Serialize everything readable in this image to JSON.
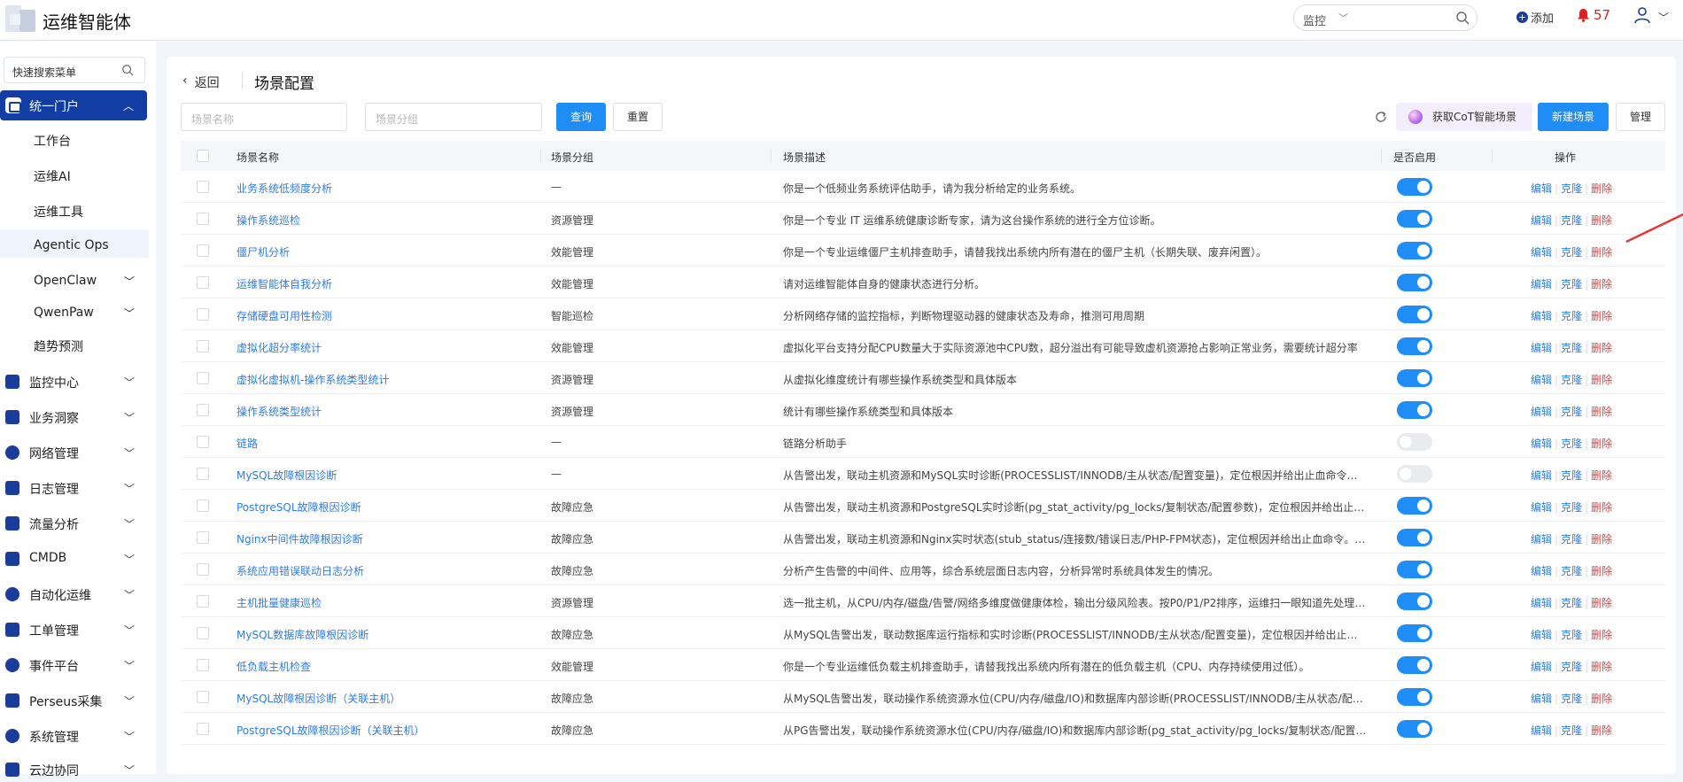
{
  "header": {
    "app_title": "运维智能体",
    "search_scope": "监控",
    "add_label": "添加",
    "alert_count": "57"
  },
  "sidebar": {
    "search_placeholder": "快速搜索菜单",
    "active": "统一门户",
    "sub_items": [
      "工作台",
      "运维AI",
      "运维工具",
      "Agentic Ops",
      "OpenClaw",
      "QwenPaw",
      "趋势预测"
    ],
    "main_items": [
      "监控中心",
      "业务洞察",
      "网络管理",
      "日志管理",
      "流量分析",
      "CMDB",
      "自动化运维",
      "工单管理",
      "事件平台",
      "Perseus采集",
      "系统管理",
      "云边协同"
    ]
  },
  "page": {
    "back_label": "返回",
    "title": "场景配置",
    "name_placeholder": "场景名称",
    "group_placeholder": "场景分组",
    "query_label": "查询",
    "reset_label": "重置",
    "cot_label": "获取CoT智能场景",
    "new_label": "新建场景",
    "manage_label": "管理"
  },
  "table": {
    "columns": [
      "场景名称",
      "场景分组",
      "场景描述",
      "是否启用",
      "操作"
    ],
    "op_labels": {
      "edit": "编辑",
      "clone": "克隆",
      "delete": "删除"
    },
    "rows": [
      {
        "name": "业务系统低频度分析",
        "group": "—",
        "desc": "你是一个低频业务系统评估助手，请为我分析给定的业务系统。",
        "enabled": true
      },
      {
        "name": "操作系统巡检",
        "group": "资源管理",
        "desc": "你是一个专业 IT 运维系统健康诊断专家，请为这台操作系统的进行全方位诊断。",
        "enabled": true
      },
      {
        "name": "僵尸机分析",
        "group": "效能管理",
        "desc": "你是一个专业运维僵尸主机排查助手，请替我找出系统内所有潜在的僵尸主机（长期失联、废弃闲置）。",
        "enabled": true
      },
      {
        "name": "运维智能体自我分析",
        "group": "效能管理",
        "desc": "请对运维智能体自身的健康状态进行分析。",
        "enabled": true
      },
      {
        "name": "存储硬盘可用性检测",
        "group": "智能巡检",
        "desc": "分析网络存储的监控指标，判断物理驱动器的健康状态及寿命，推测可用周期",
        "enabled": true
      },
      {
        "name": "虚拟化超分率统计",
        "group": "效能管理",
        "desc": "虚拟化平台支持分配CPU数量大于实际资源池中CPU数，超分溢出有可能导致虚机资源抢占影响正常业务，需要统计超分率",
        "enabled": true
      },
      {
        "name": "虚拟化虚拟机-操作系统类型统计",
        "group": "资源管理",
        "desc": "从虚拟化维度统计有哪些操作系统类型和具体版本",
        "enabled": true
      },
      {
        "name": "操作系统类型统计",
        "group": "资源管理",
        "desc": "统计有哪些操作系统类型和具体版本",
        "enabled": true
      },
      {
        "name": "链路",
        "group": "—",
        "desc": "链路分析助手",
        "enabled": false
      },
      {
        "name": "MySQL故障根因诊断",
        "group": "—",
        "desc": "从告警出发，联动主机资源和MySQL实时诊断(PROCESSLIST/INNODB/主从状态/配置变量)，定位根因并给出止血命令。…",
        "enabled": false
      },
      {
        "name": "PostgreSQL故障根因诊断",
        "group": "故障应急",
        "desc": "从告警出发，联动主机资源和PostgreSQL实时诊断(pg_stat_activity/pg_locks/复制状态/配置参数)，定位根因并给出止血…",
        "enabled": true
      },
      {
        "name": "Nginx中间件故障根因诊断",
        "group": "故障应急",
        "desc": "从告警出发，联动主机资源和Nginx实时状态(stub_status/连接数/错误日志/PHP-FPM状态)，定位根因并给出止血命令。…",
        "enabled": true
      },
      {
        "name": "系统应用错误联动日志分析",
        "group": "故障应急",
        "desc": "分析产生告警的中间件、应用等，综合系统层面日志内容，分析异常时系统具体发生的情况。",
        "enabled": true
      },
      {
        "name": "主机批量健康巡检",
        "group": "资源管理",
        "desc": "选一批主机，从CPU/内存/磁盘/告警/网络多维度做健康体检，输出分级风险表。按P0/P1/P2排序，运维扫一眼知道先处理…",
        "enabled": true
      },
      {
        "name": "MySQL数据库故障根因诊断",
        "group": "故障应急",
        "desc": "从MySQL告警出发，联动数据库运行指标和实时诊断(PROCESSLIST/INNODB/主从状态/配置变量)，定位根因并给出止血…",
        "enabled": true
      },
      {
        "name": "低负载主机检查",
        "group": "效能管理",
        "desc": "你是一个专业运维低负载主机排查助手，请替我找出系统内所有潜在的低负载主机（CPU、内存持续使用过低）。",
        "enabled": true
      },
      {
        "name": "MySQL故障根因诊断（关联主机）",
        "group": "故障应急",
        "desc": "从MySQL告警出发，联动操作系统资源水位(CPU/内存/磁盘/IO)和数据库内部诊断(PROCESSLIST/INNODB/主从状态/配…",
        "enabled": true
      },
      {
        "name": "PostgreSQL故障根因诊断（关联主机）",
        "group": "故障应急",
        "desc": "从PG告警出发，联动操作系统资源水位(CPU/内存/磁盘/IO)和数据库内部诊断(pg_stat_activity/pg_locks/复制状态/配置…",
        "enabled": true
      }
    ]
  },
  "colors": {
    "primary": "#1e8df5",
    "brand": "#123ea4",
    "danger": "#e04040",
    "link": "#2d7de6"
  }
}
